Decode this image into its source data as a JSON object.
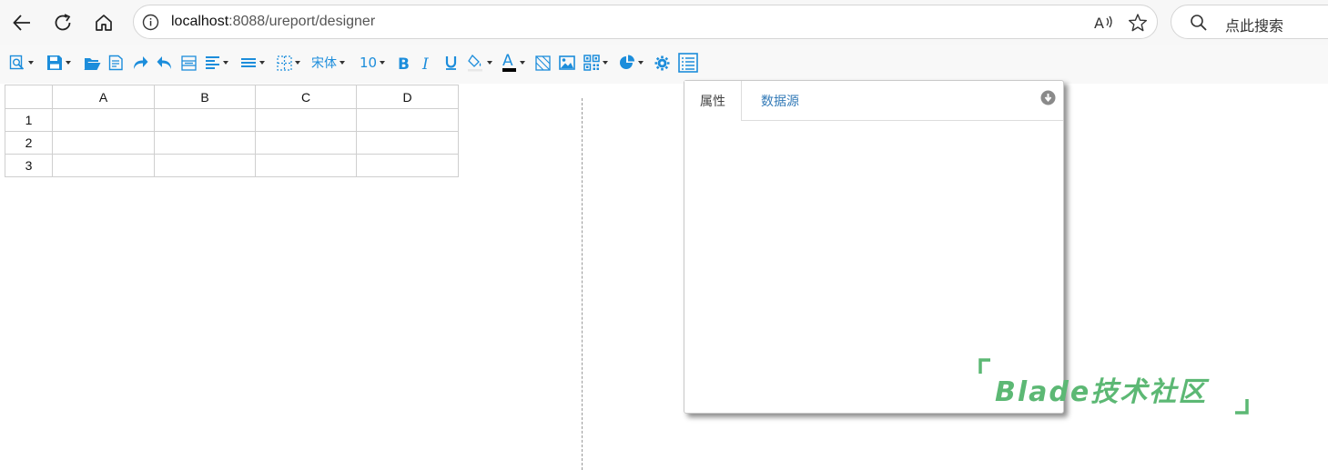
{
  "browser": {
    "url_host": "localhost",
    "url_path": ":8088/ureport/designer",
    "search_placeholder": "点此搜索"
  },
  "toolbar": {
    "font_name": "宋体",
    "font_size": "10",
    "icons": [
      "preview-icon",
      "save-icon",
      "open-icon",
      "import-icon",
      "redo-icon",
      "undo-icon",
      "merge-cells-icon",
      "align-left-icon",
      "vertical-align-icon",
      "border-icon",
      "bold-icon",
      "italic-icon",
      "underline-icon",
      "fill-color-icon",
      "font-color-icon",
      "slash-icon",
      "image-icon",
      "qrcode-icon",
      "chart-icon",
      "settings-icon",
      "property-list-icon"
    ],
    "accent_color": "#1c8ddb",
    "font_color_bar": "#000000"
  },
  "grid": {
    "columns": [
      "",
      "A",
      "B",
      "C",
      "D"
    ],
    "rows": [
      "1",
      "2",
      "3"
    ]
  },
  "panel": {
    "tabs": [
      {
        "label": "属性",
        "active": true
      },
      {
        "label": "数据源",
        "active": false
      }
    ],
    "link_color": "#337ab7"
  },
  "watermark": {
    "text": "Blade技术社区",
    "color": "#5cb874"
  }
}
